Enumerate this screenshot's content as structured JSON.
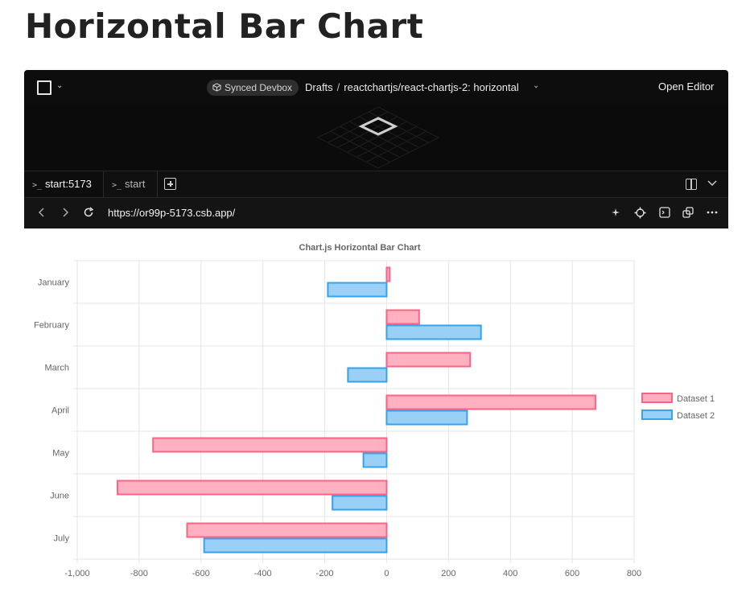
{
  "page": {
    "heading": "Horizontal Bar Chart"
  },
  "topbar": {
    "badge_label": "Synced Devbox",
    "breadcrumb": [
      "Drafts",
      "reactchartjs/react-chartjs-2: horizontal"
    ],
    "open_editor_label": "Open Editor"
  },
  "tabs": [
    {
      "label": "start:5173",
      "active": true
    },
    {
      "label": "start",
      "active": false
    }
  ],
  "browser": {
    "url": "https://or99p-5173.csb.app/"
  },
  "icons": {
    "menu": "square-menu-icon",
    "badge": "cube-icon",
    "logo": "diamond-logo-icon",
    "tab_prompt": "terminal-prompt-icon",
    "add_tab": "plus-square-icon",
    "split": "split-view-icon",
    "collapse": "chevron-down-icon",
    "back": "arrow-left-icon",
    "forward": "arrow-right-icon",
    "reload": "reload-icon",
    "sparkle": "sparkle-icon",
    "inspect": "crosshair-icon",
    "console": "terminal-icon",
    "popout": "popout-icon",
    "more": "more-icon"
  },
  "colors": {
    "dataset1_fill": "#ffb1c1",
    "dataset1_border": "#ff6384",
    "dataset2_fill": "#9ad0f5",
    "dataset2_border": "#36a2eb"
  },
  "chart_data": {
    "type": "bar",
    "orientation": "horizontal",
    "title": "Chart.js Horizontal Bar Chart",
    "categories": [
      "January",
      "February",
      "March",
      "April",
      "May",
      "June",
      "July"
    ],
    "series": [
      {
        "name": "Dataset 1",
        "values": [
          10,
          105,
          270,
          675,
          -755,
          -870,
          -645
        ]
      },
      {
        "name": "Dataset 2",
        "values": [
          -190,
          305,
          -125,
          260,
          -75,
          -175,
          -590
        ]
      }
    ],
    "xlim": [
      -1000,
      800
    ],
    "xticks": [
      "-1,000",
      "-800",
      "-600",
      "-400",
      "-200",
      "0",
      "200",
      "400",
      "600",
      "800"
    ],
    "grid": true,
    "legend_position": "right"
  }
}
